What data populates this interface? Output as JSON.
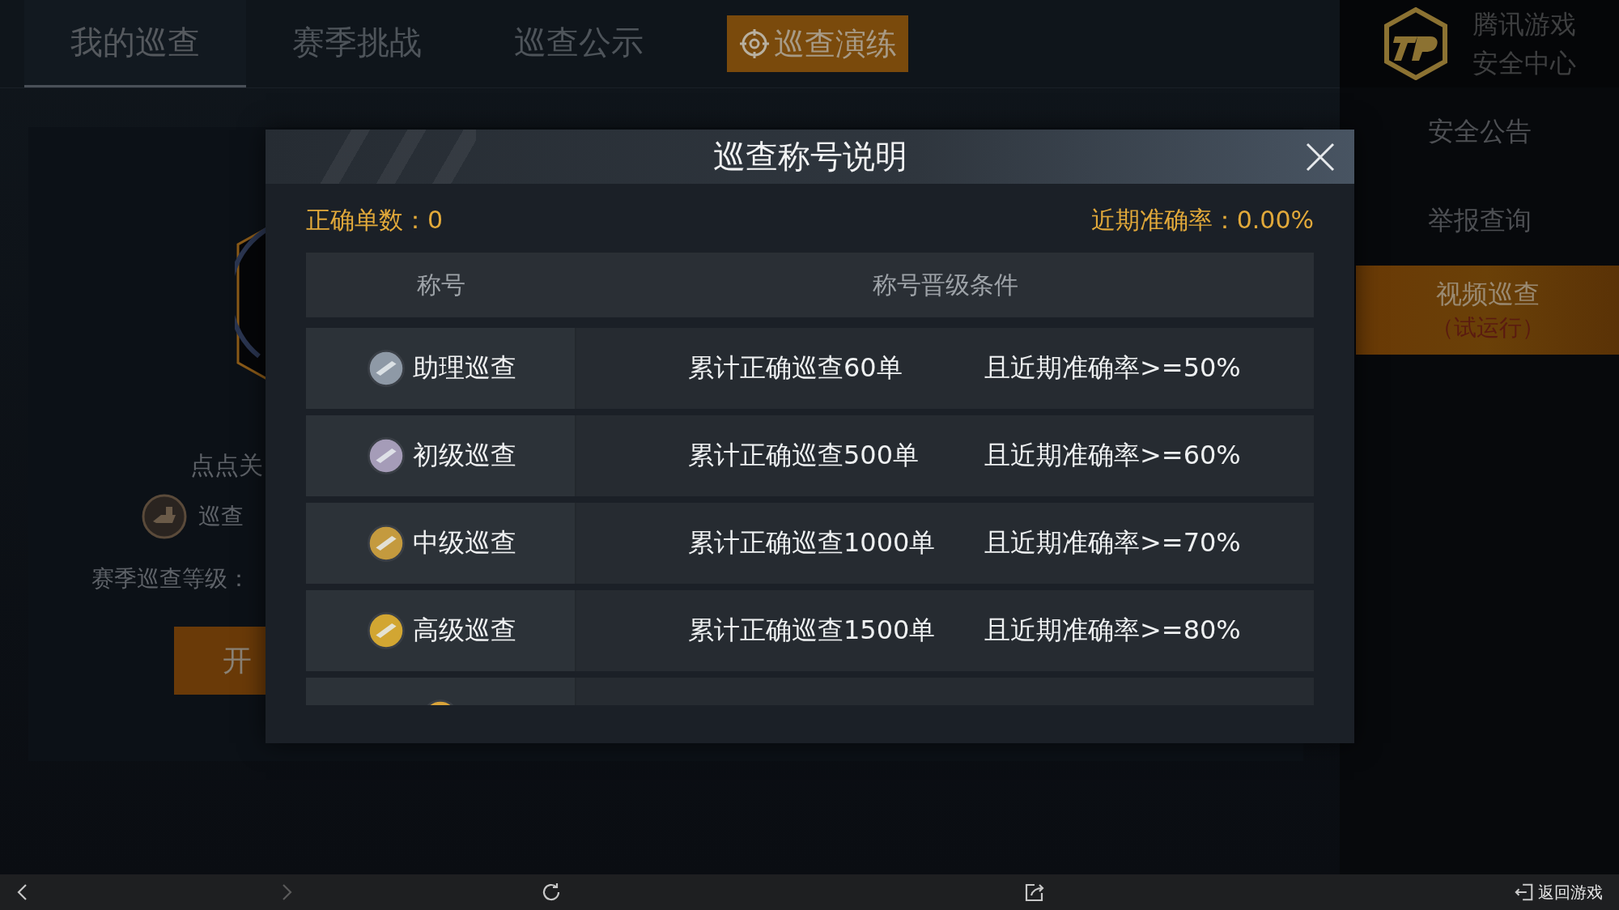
{
  "tabs": [
    {
      "label": "我的巡查",
      "selected": true
    },
    {
      "label": "赛季挑战",
      "selected": false
    },
    {
      "label": "巡查公示",
      "selected": false
    }
  ],
  "practice_button": {
    "label": "巡查演练"
  },
  "sidebar": {
    "logo_lines": [
      "腾讯游戏",
      "安全中心"
    ],
    "items": [
      {
        "label": "安全公告",
        "selected": false
      },
      {
        "label": "举报查询",
        "selected": false
      },
      {
        "label": "视频巡查",
        "sublabel": "（试运行）",
        "selected": true
      }
    ]
  },
  "background_panel": {
    "follow_text": "点点关",
    "patrol_text": "巡查",
    "season_level_label": "赛季巡查等级：",
    "start_button": "开"
  },
  "modal": {
    "title": "巡查称号说明",
    "correct_count": "正确单数：0",
    "accuracy": "近期准确率：0.00%",
    "columns": [
      "称号",
      "称号晋级条件"
    ],
    "rows": [
      {
        "title": "助理巡查",
        "count_condition": "累计正确巡查60单",
        "accuracy_condition": "且近期准确率>=50%",
        "color": "#8e99a6"
      },
      {
        "title": "初级巡查",
        "count_condition": "累计正确巡查500单",
        "accuracy_condition": "且近期准确率>=60%",
        "color": "#a59cb8"
      },
      {
        "title": "中级巡查",
        "count_condition": "累计正确巡查1000单",
        "accuracy_condition": "且近期准确率>=70%",
        "color": "#c49a3e"
      },
      {
        "title": "高级巡查",
        "count_condition": "累计正确巡查1500单",
        "accuracy_condition": "且近期准确率>=80%",
        "color": "#d2a632"
      },
      {
        "color": "#d9a43a"
      }
    ]
  },
  "bottom_bar": {
    "return_label": "返回游戏"
  }
}
